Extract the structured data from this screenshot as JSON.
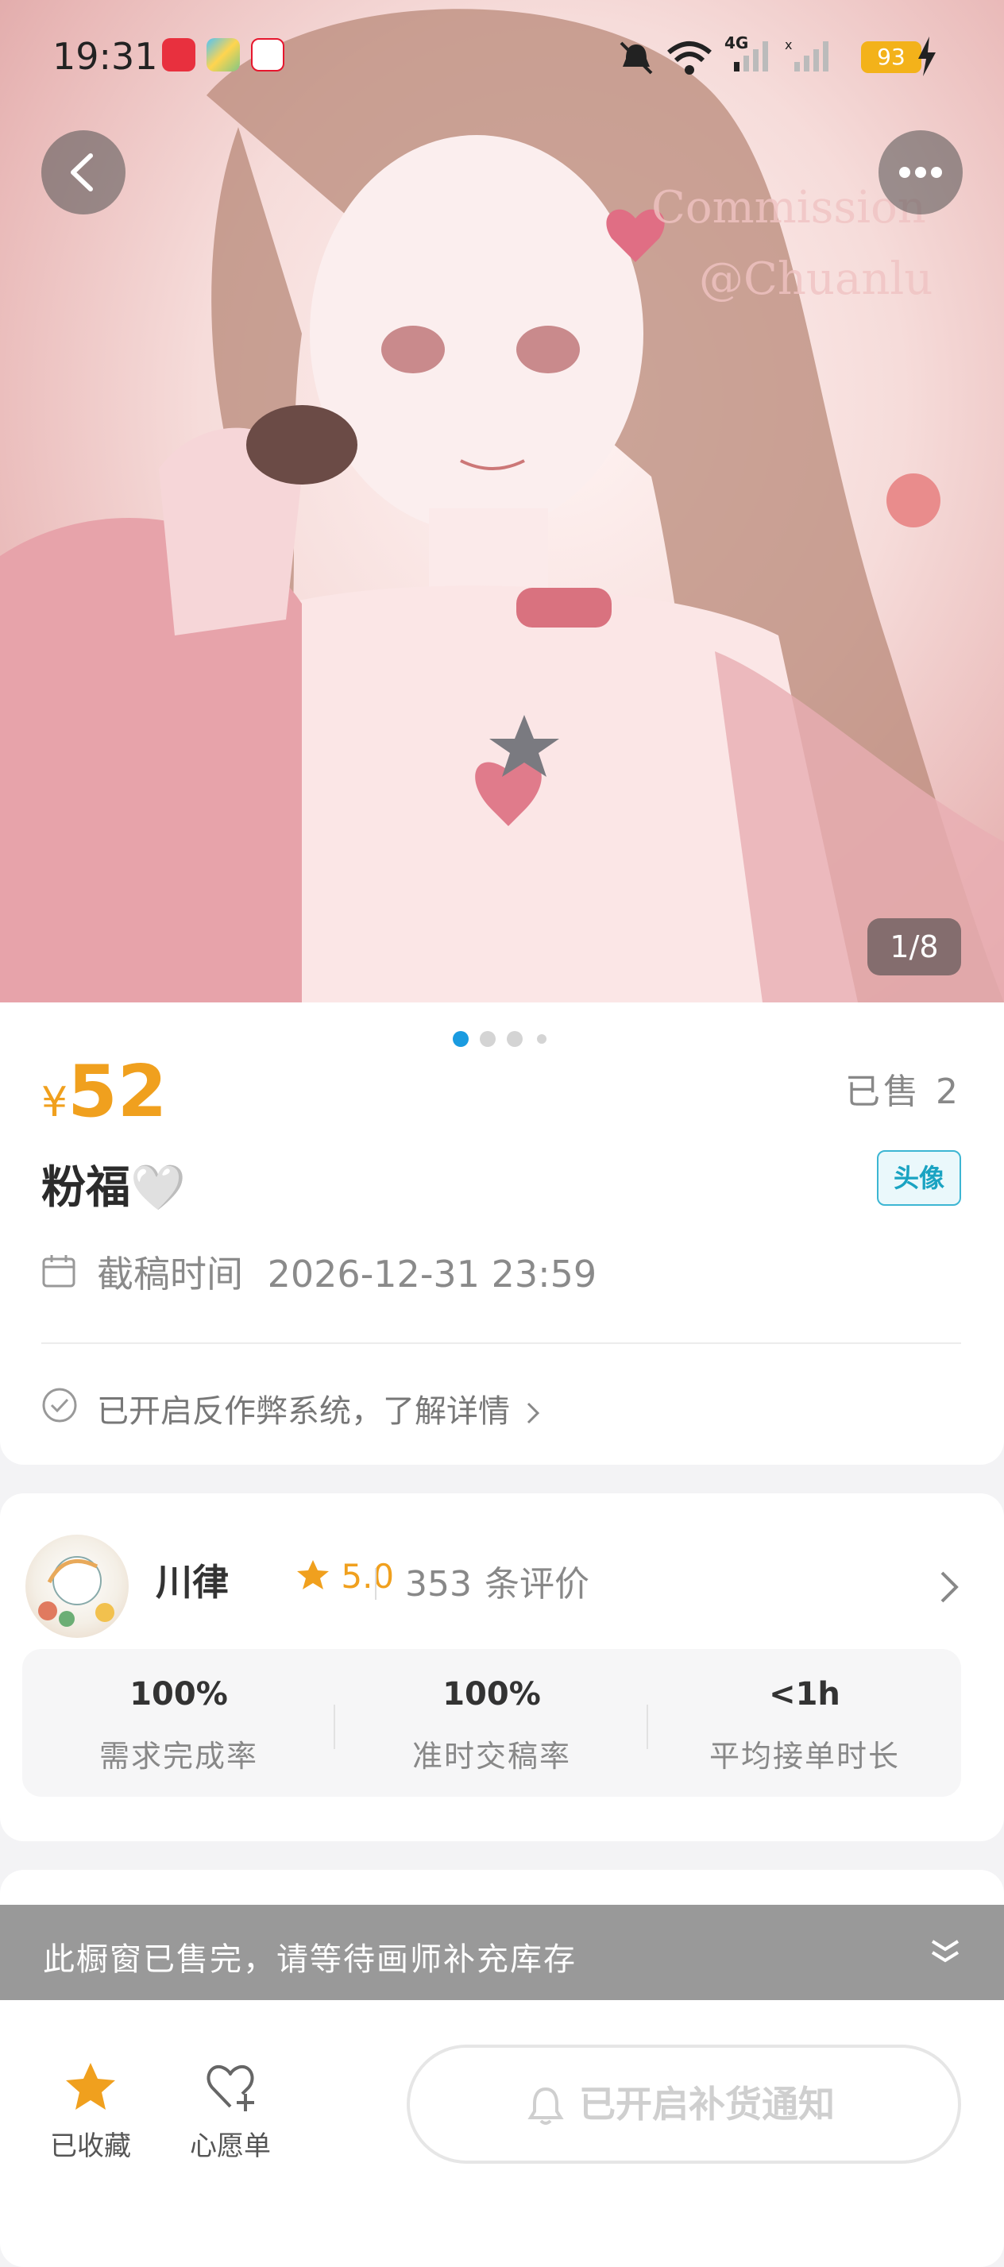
{
  "status_bar": {
    "time": "19:31",
    "network": "4G",
    "battery": "93"
  },
  "hero": {
    "image_counter": "1/8",
    "carousel_pages": 4,
    "carousel_active": 1
  },
  "product": {
    "currency": "¥",
    "price": "52",
    "sold": "已售 2",
    "title": "粉福🤍",
    "tag": "头像",
    "deadline_label": "截稿时间",
    "deadline_value": "2026-12-31 23:59",
    "anti_cheat": "已开启反作弊系统，了解详情"
  },
  "artist": {
    "name": "川律",
    "rating": "5.0",
    "review_count": "353",
    "review_suffix": "条评价",
    "stats": [
      {
        "value": "100%",
        "label": "需求完成率"
      },
      {
        "value": "100%",
        "label": "准时交稿率"
      },
      {
        "value": "<1h",
        "label": "平均接单时长"
      }
    ]
  },
  "banner": {
    "text": "此橱窗已售完，请等待画师补充库存"
  },
  "bottom_bar": {
    "favorite_label": "已收藏",
    "wishlist_label": "心愿单",
    "notify_label": "已开启补货通知"
  },
  "colors": {
    "accent_orange": "#f0a01e",
    "tag_blue": "#1aa3c2",
    "dot_active": "#1a9be0"
  }
}
